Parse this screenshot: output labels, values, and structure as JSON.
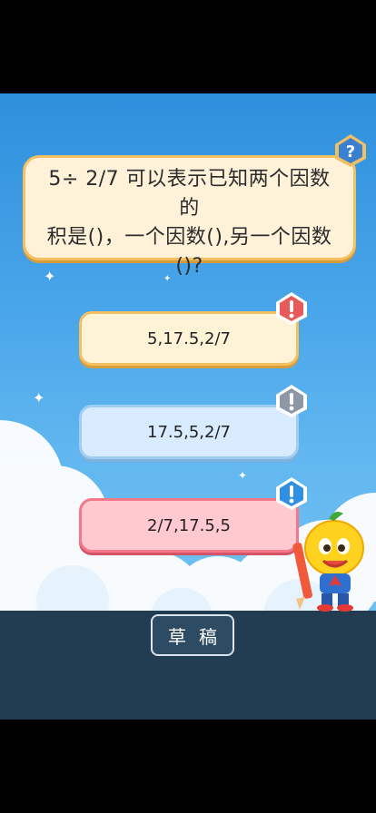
{
  "question": {
    "text_line1": "5÷ 2/7 可以表示已知两个因数的",
    "text_line2": "积是()，一个因数(),另一个因数",
    "text_line3": "()?",
    "help_icon": "question-mark-badge"
  },
  "options": [
    {
      "label": "5,17.5,2/7",
      "badge": "exclamation-badge",
      "badge_color": "#e85a5a"
    },
    {
      "label": "17.5,5,2/7",
      "badge": "exclamation-badge",
      "badge_color": "#8e97a6"
    },
    {
      "label": "2/7,17.5,5",
      "badge": "exclamation-badge",
      "badge_color": "#2f8fe0"
    }
  ],
  "toolbar": {
    "draft_label": "草稿"
  },
  "colors": {
    "sky": "#4aa6ea",
    "bottom_bar": "#223d52",
    "option_orange": "#f1c063",
    "option_blue": "#9fcdf4",
    "option_red": "#f2788a"
  }
}
